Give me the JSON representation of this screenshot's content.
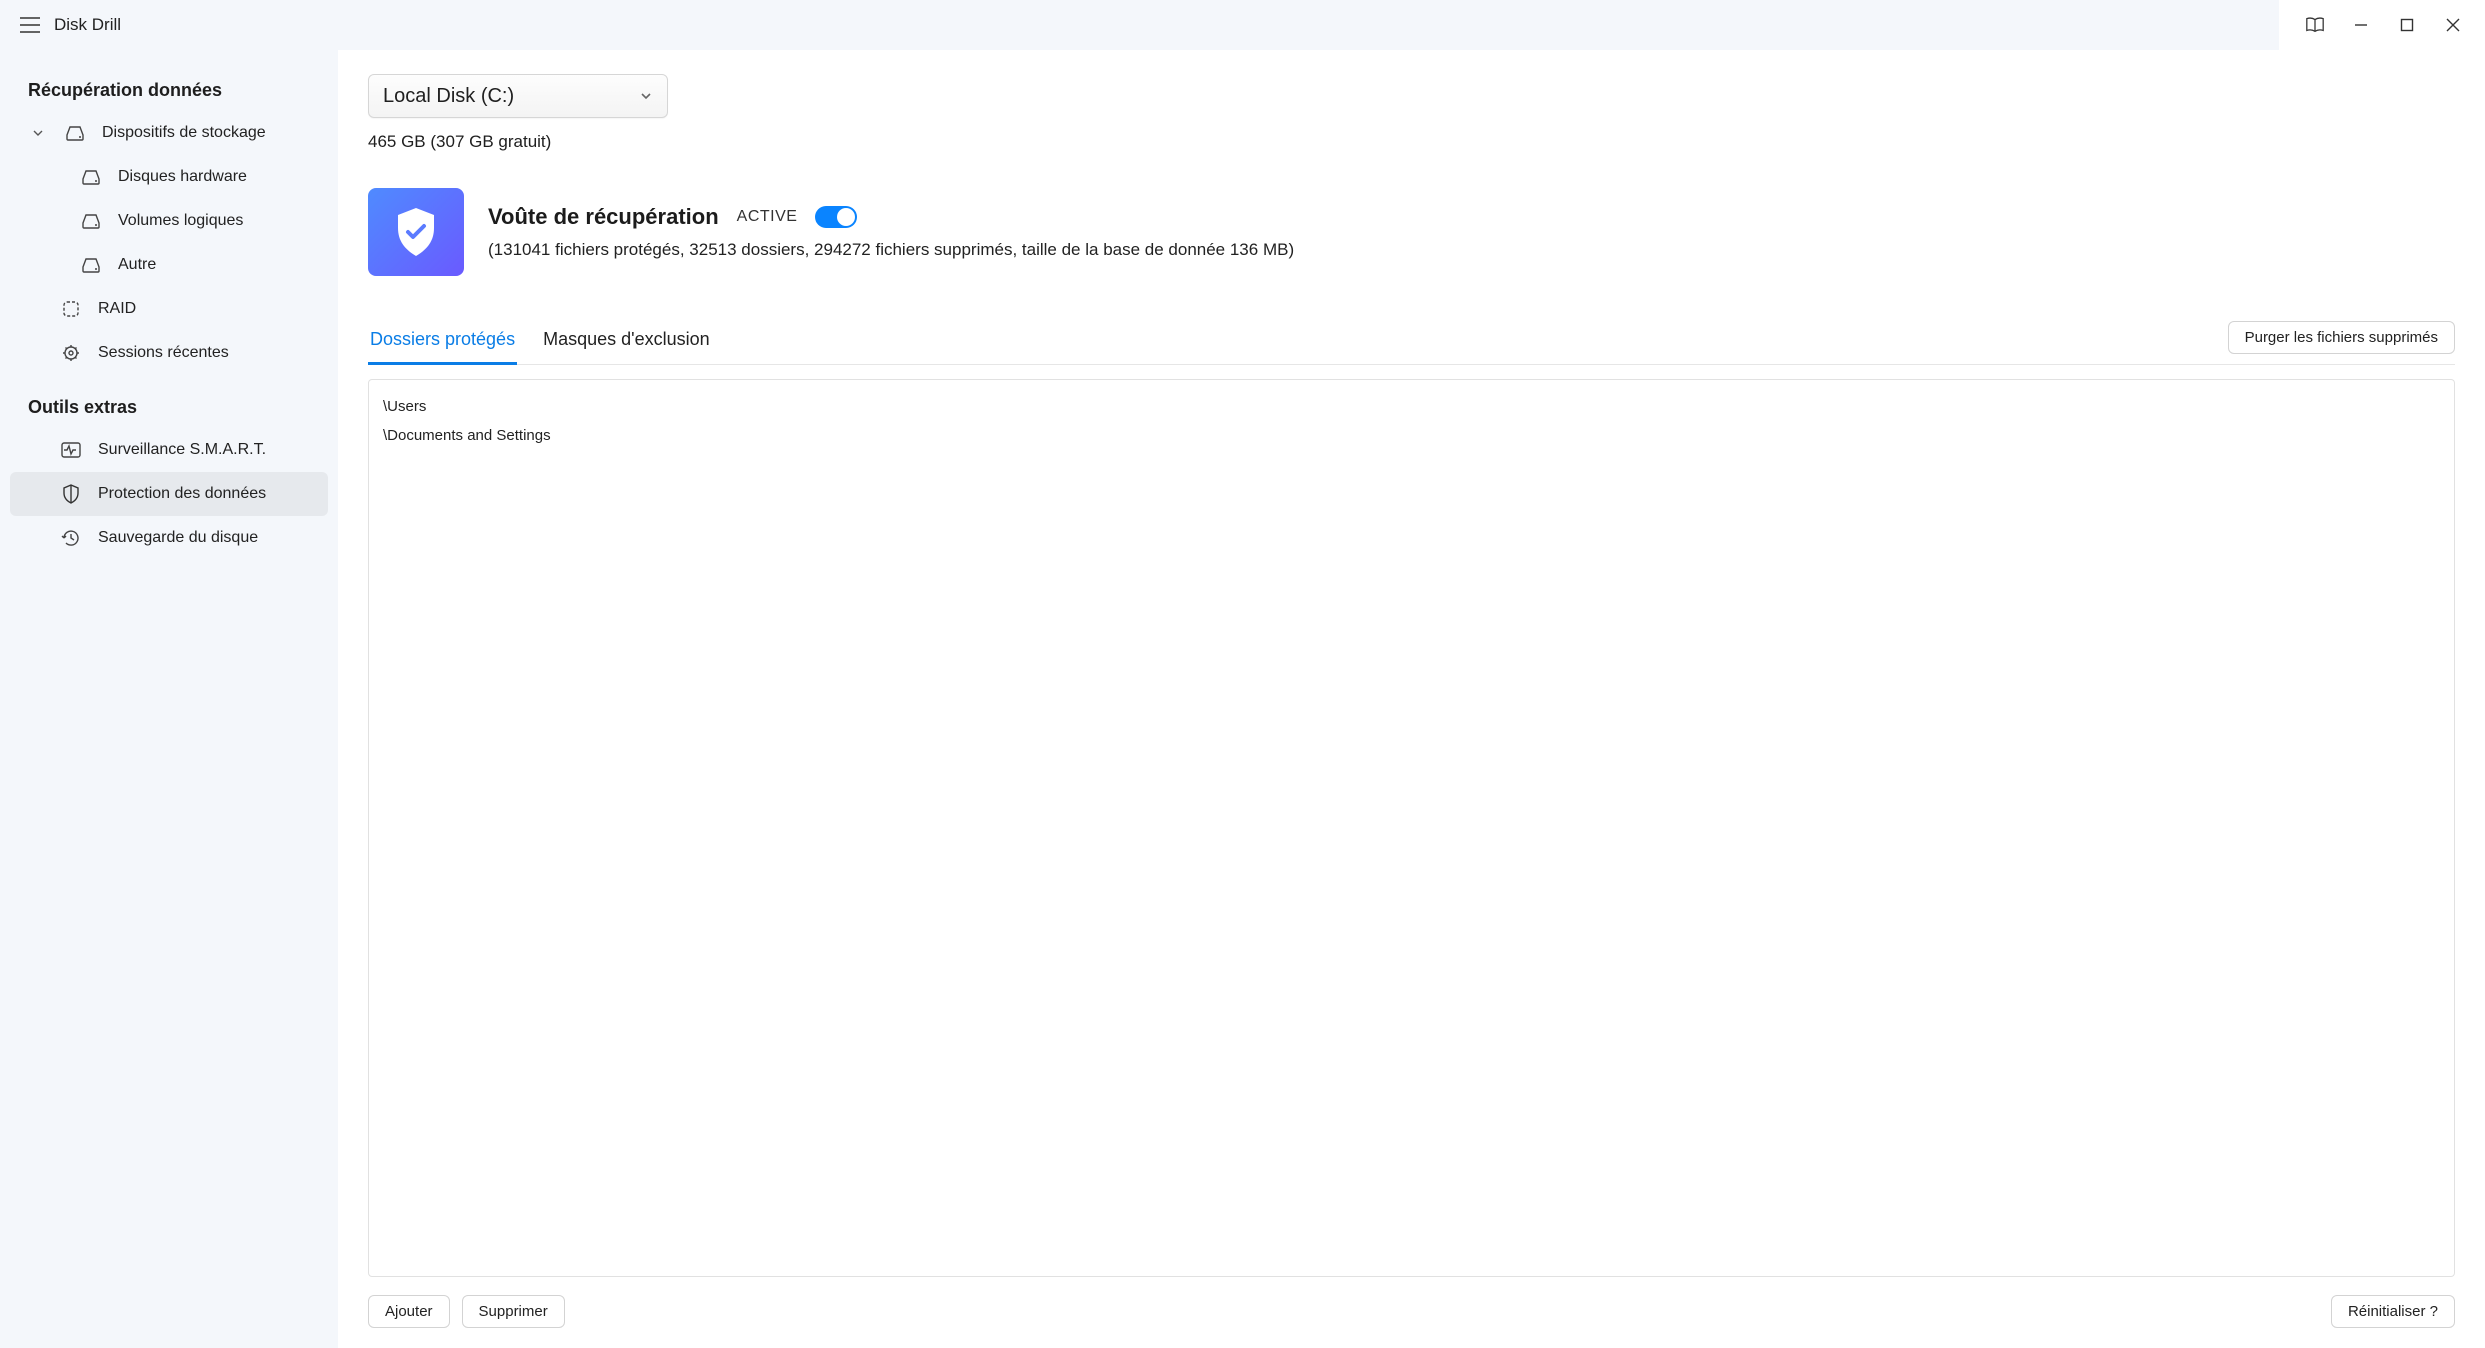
{
  "app": {
    "title": "Disk Drill"
  },
  "sidebar": {
    "section1_title": "Récupération données",
    "storage_devices": {
      "label": "Dispositifs de stockage"
    },
    "hardware_disks": {
      "label": "Disques hardware"
    },
    "logical_volumes": {
      "label": "Volumes logiques"
    },
    "other": {
      "label": "Autre"
    },
    "raid": {
      "label": "RAID"
    },
    "recent_sessions": {
      "label": "Sessions récentes"
    },
    "section2_title": "Outils extras",
    "smart": {
      "label": "Surveillance S.M.A.R.T."
    },
    "data_protection": {
      "label": "Protection des données"
    },
    "disk_backup": {
      "label": "Sauvegarde du disque"
    }
  },
  "main": {
    "disk_select": {
      "value": "Local Disk (C:)"
    },
    "disk_info": "465 GB (307 GB gratuit)",
    "vault": {
      "title": "Voûte de récupération",
      "status": "ACTIVE",
      "stats": "(131041 fichiers protégés, 32513 dossiers, 294272 fichiers supprimés, taille de la base de donnée 136 MB)"
    },
    "tabs": {
      "protected_folders": "Dossiers protégés",
      "exclusion_masks": "Masques d'exclusion"
    },
    "purge_btn": "Purger les fichiers supprimés",
    "folders": [
      "\\Users",
      "\\Documents and Settings"
    ],
    "actions": {
      "add": "Ajouter",
      "remove": "Supprimer",
      "reset": "Réinitialiser ?"
    }
  }
}
